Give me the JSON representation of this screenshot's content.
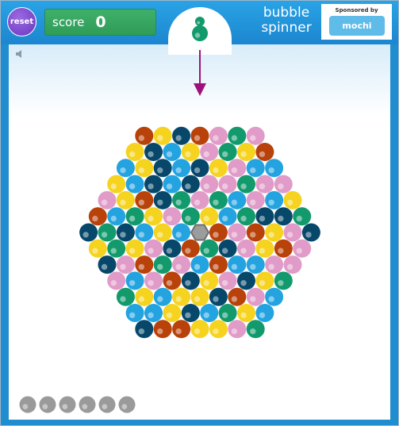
{
  "header": {
    "reset_label": "reset",
    "score_label": "score",
    "score_value": "0",
    "title": "bubble spinner",
    "sponsor_text": "Sponsored by",
    "sponsor_logo_text": "mochi"
  },
  "icons": {
    "sound": "speaker-icon",
    "aim": "down-arrow-icon"
  },
  "colors": {
    "yellow": "#f5d31e",
    "blue": "#23a3e0",
    "navy": "#07486a",
    "brown": "#b9410a",
    "green": "#129a6c",
    "pink": "#e19bc8",
    "center": "#9c9c9c",
    "remaining": "#9a9a9a",
    "arrow": "#a0107a"
  },
  "game": {
    "loaded_bubble_color": "green",
    "next_bubble_color": "green",
    "remaining_shots": 6
  }
}
